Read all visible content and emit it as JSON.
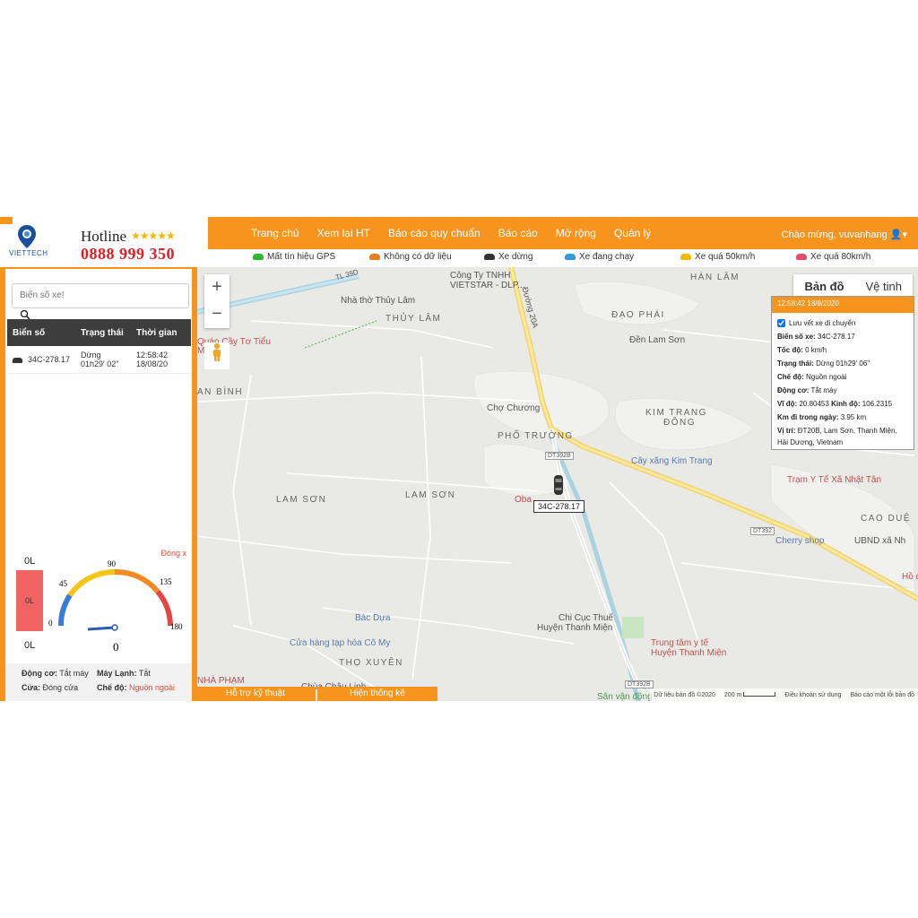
{
  "brand": {
    "logo_text": "VIETTECH",
    "hotline_label": "Hotline",
    "stars": "★★★★★",
    "phone": "0888 999 350"
  },
  "nav": {
    "items": [
      "Trang chủ",
      "Xem lại HT",
      "Báo cáo quy chuẩn",
      "Báo cáo",
      "Mở rộng",
      "Quản lý"
    ],
    "welcome": "Chào mừng, vuvanhang"
  },
  "legend": [
    {
      "label": "Mất tín hiệu GPS",
      "color": "#2eb82e"
    },
    {
      "label": "Không có dữ liệu",
      "color": "#e67e22"
    },
    {
      "label": "Xe dừng",
      "color": "#333333"
    },
    {
      "label": "Xe đang chạy",
      "color": "#3498db"
    },
    {
      "label": "Xe quá 50km/h",
      "color": "#f5b800"
    },
    {
      "label": "Xe quá 80km/h",
      "color": "#e74c6c"
    }
  ],
  "search": {
    "placeholder": "Biển số xe!"
  },
  "table": {
    "headers": [
      "Biển số",
      "Trạng thái",
      "Thời gian"
    ],
    "rows": [
      {
        "plate": "34C-278.17",
        "status1": "Dừng",
        "status2": "01h29' 02\"",
        "time1": "12:58:42",
        "time2": "18/08/20"
      }
    ]
  },
  "gauge": {
    "close": "Đóng x",
    "fuel_top": "0L",
    "fuel_mid": "0L",
    "fuel_bottom": "0L",
    "ticks": [
      "0",
      "45",
      "90",
      "135",
      "180"
    ],
    "speed": "0",
    "engine_label": "Động cơ:",
    "engine_value": "Tắt máy",
    "ac_label": "Máy Lạnh:",
    "ac_value": "Tắt",
    "door_label": "Cửa:",
    "door_value": "Đóng cửa",
    "mode_label": "Chế độ:",
    "mode_value": "Nguồn ngoài"
  },
  "map": {
    "type_tabs": [
      "Bản đồ",
      "Vệ tinh"
    ],
    "labels": {
      "hanlam": "HÀN LÂM",
      "thuylam": "THỦY LÂM",
      "daophai": "ĐẠO PHÁI",
      "kimtrang": "KIM TRANG",
      "dong": "ĐÔNG",
      "photruong": "PHỐ TRƯỜNG",
      "lamson1": "LAM SƠN",
      "lamson2": "LAM SƠN",
      "anbinh": "AN BÌNH",
      "caoduc": "CAO DUỆ",
      "thoxuyen": "THỌ XUYÊN",
      "cty": "Công Ty TNHH",
      "vietstar": "VIETSTAR - DLP...",
      "nhatho": "Nhà thờ Thủy Lâm",
      "quan1": "Quán Cầy Tơ Tiểu",
      "quan2": "MƯỜI)",
      "denlamson": "Đền Lam Sơn",
      "chochuong": "Chợ Chương",
      "cayxang": "Cây xăng Kim Trang",
      "tramyte": "Trạm Y Tế Xã Nhật Tân",
      "cherry": "Cherry shop",
      "ubnd": "UBND xã Nh",
      "bacdua": "Bác Dựa",
      "cuahang": "Cửa hàng tạp hóa Cô My",
      "chicuc1": "Chi Cục Thuế",
      "chicuc2": "Huyện Thanh Miện",
      "trungtam1": "Trung tâm y tế",
      "trungtam2": "Huyện Thanh Miện",
      "nhapham": "NHÀ PHẠM",
      "chua": "Chùa Châu Linh",
      "svd": "Sân vận động",
      "oba": "Oba",
      "ho": "Hồ c",
      "tl39d": "TL 39D",
      "duong20a": "Đường 20A",
      "dt392b1": "DT392B",
      "dt392b2": "DT392B",
      "dt392": "DT392"
    },
    "plate": "34C-278.17",
    "footer": [
      "Dữ liệu bản đồ ©2020",
      "200 m",
      "Điều khoản sử dụng",
      "Báo cáo một lỗi bản đồ"
    ]
  },
  "infobox": {
    "title": "12:58:42 18/8/2020",
    "track_label": "Lưu vết xe di chuyển",
    "plate_label": "Biển số xe:",
    "plate": "34C-278.17",
    "speed_label": "Tốc độ:",
    "speed": "0 km/h",
    "status_label": "Trạng thái:",
    "status": "Dừng 01h29' 06\"",
    "mode_label": "Chế độ:",
    "mode": "Nguồn ngoài",
    "engine_label": "Động cơ:",
    "engine": "Tắt máy",
    "lat_label": "Vĩ độ:",
    "lat": "20.80453",
    "lng_label": "Kinh độ:",
    "lng": "106.2315",
    "km_label": "Km đi trong ngày:",
    "km": "3.95 km",
    "pos_label": "Vị trí:",
    "pos": "ĐT20B, Lam Sơn, Thanh Miện, Hải Dương, Vietnam"
  },
  "bottom_tabs": [
    "Hỗ trợ kỹ thuật",
    "Hiện thống kê"
  ]
}
